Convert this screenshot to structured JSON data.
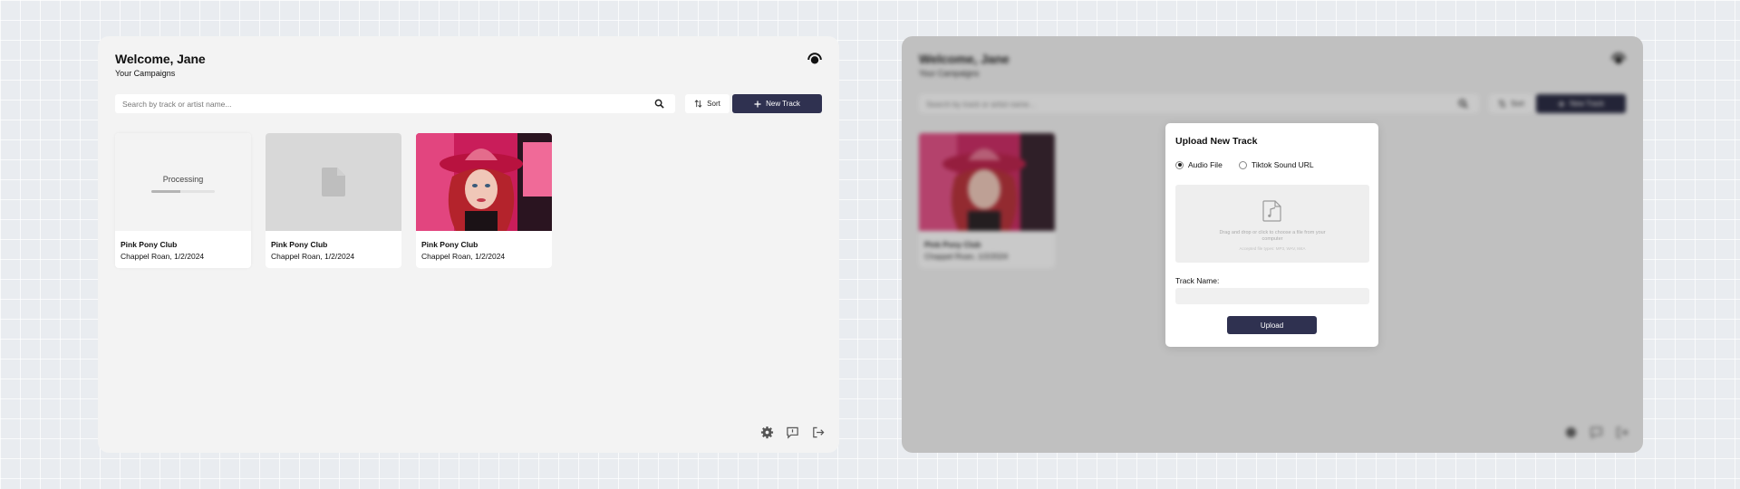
{
  "header": {
    "title": "Welcome, Jane",
    "subtitle": "Your Campaigns"
  },
  "search": {
    "placeholder": "Search by track or artist name..."
  },
  "toolbar": {
    "sort_label": "Sort",
    "new_track_label": "New Track"
  },
  "tracks": [
    {
      "title": "Pink Pony Club",
      "subtitle": "Chappel Roan, 1/2/2024",
      "state": "processing",
      "processing_label": "Processing",
      "progress": 0.45
    },
    {
      "title": "Pink Pony Club",
      "subtitle": "Chappel Roan, 1/2/2024",
      "state": "placeholder"
    },
    {
      "title": "Pink Pony Club",
      "subtitle": "Chappel Roan, 1/2/2024",
      "state": "cover-art"
    }
  ],
  "footer_icons": [
    "settings-icon",
    "feedback-icon",
    "logout-icon"
  ],
  "modal": {
    "title": "Upload New Track",
    "source_options": [
      {
        "label": "Audio File",
        "selected": true
      },
      {
        "label": "Tiktok Sound URL",
        "selected": false
      }
    ],
    "dropzone": {
      "text": "Drag and drop or click to choose a file from your computer",
      "accepted": "Accepted file types: MP3, WAV, M4A"
    },
    "track_name_label": "Track Name:",
    "track_name_value": "",
    "upload_label": "Upload"
  },
  "colors": {
    "accent": "#2f3150",
    "panel_bg": "#f3f3f3",
    "page_bg": "#e9ecf0"
  }
}
